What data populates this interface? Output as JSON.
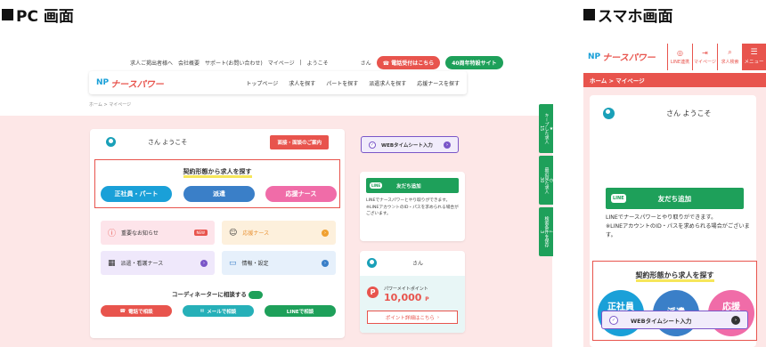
{
  "sections": {
    "pc_title": "PC 画面",
    "sp_title": "スマホ画面"
  },
  "pc": {
    "topnav": [
      "求人ご掲出者様へ",
      "会社概要",
      "サポート(お問い合わせ)",
      "マイページ",
      "|",
      "ようこそ",
      "さん"
    ],
    "phone_btn": "電話受付はこちら",
    "anniv_btn": "40周年特設サイト",
    "logo_np": "NP",
    "logo_text": "ナースパワー",
    "mainnav": [
      "トップページ",
      "求人を探す",
      "パートを探す",
      "派遣求人を探す",
      "応援ナースを探す"
    ],
    "breadcrumb": "ホーム > マイページ",
    "welcome": "さん ようこそ",
    "consult_btn": "面接・面談のご案内",
    "keiyaku_title": "契約形態から求人を探す",
    "pills": [
      "正社員・パート",
      "派遣",
      "応援ナース"
    ],
    "tiles": [
      "重要なお知らせ",
      "応援ナース",
      "派遣・看護ナース",
      "情報・設定"
    ],
    "new_badge": "NEW",
    "coord_title": "コーディネーターに相談する",
    "contact_btns": [
      "電話で相談",
      "メールで相談",
      "LINEで相談"
    ],
    "web_btn": "WEBタイムシート入力",
    "line_bar": "友だち追加",
    "line_text1": "LINEでナースパワーとやり取りができます。",
    "line_text2": "※LINEアカウントのID・パスを求められる場合がございます。",
    "point_name": "さん",
    "point_label": "パワーメイトポイント",
    "point_value": "10,000",
    "point_unit": "P",
    "point_btn": "ポイント詳細はこちら",
    "side_tabs": [
      {
        "label": "キープした求人",
        "count": "15"
      },
      {
        "label": "最近見た求人",
        "count": "30"
      },
      {
        "label": "検索条件を保存",
        "count": "3"
      }
    ]
  },
  "sp": {
    "icons": [
      "LINE連携",
      "マイページ",
      "求人検索"
    ],
    "menu": "メニュー",
    "breadcrumb": "ホーム > マイページ",
    "welcome": "さん ようこそ",
    "line_bar": "友だち追加",
    "line_text1": "LINEでナースパワーとやり取りができます。",
    "line_text2": "※LINEアカウントのID・パスを求められる場合がございます。",
    "keiyaku_title": "契約形態から求人を探す",
    "circles": [
      "正社員\nパート",
      "派遣",
      "応援\nナース"
    ],
    "web_btn": "WEBタイムシート入力"
  },
  "colors": {
    "red": "#e8544d",
    "green": "#1ea05a",
    "blue": "#1aa0d8",
    "pink": "#f06ca8",
    "purple": "#7a56c8",
    "pinkbg": "#fde7e7"
  }
}
